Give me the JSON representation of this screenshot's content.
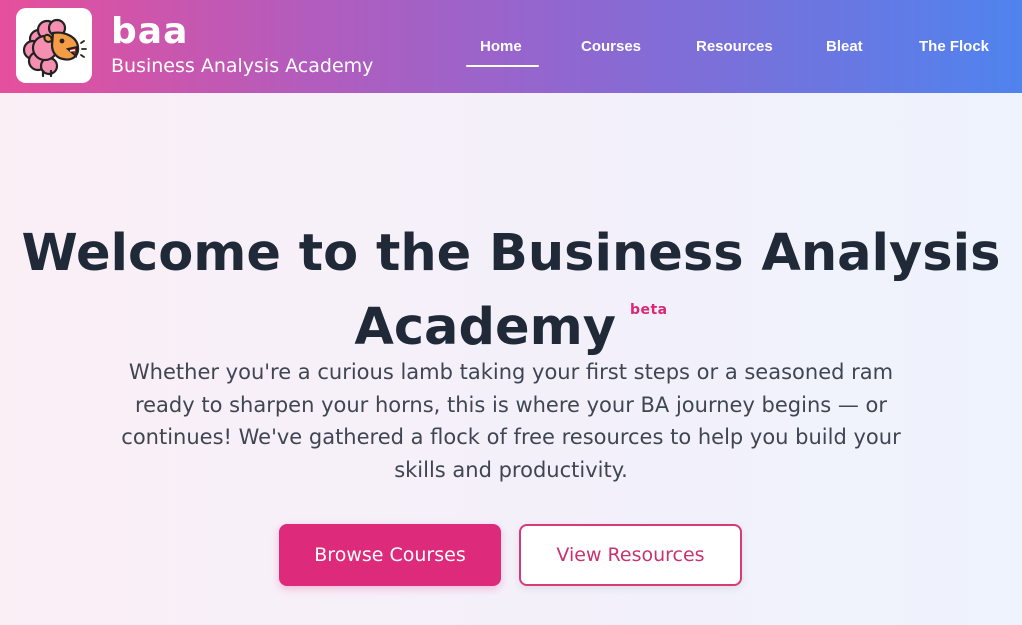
{
  "brand": {
    "name": "baa",
    "subtitle": "Business Analysis Academy",
    "logo_icon": "sheep-mascot-icon"
  },
  "nav": {
    "active": "Home",
    "items": [
      {
        "label": "Home"
      },
      {
        "label": "Courses"
      },
      {
        "label": "Resources"
      },
      {
        "label": "Bleat"
      },
      {
        "label": "The Flock"
      }
    ]
  },
  "hero": {
    "title": "Welcome to the Business Analysis Academy",
    "badge": "beta",
    "description": "Whether you're a curious lamb taking your first steps or a seasoned ram ready to sharpen your horns, this is where your BA journey begins — or continues! We've gathered a flock of free resources to help you build your skills and productivity.",
    "primary_button": "Browse Courses",
    "secondary_button": "View Resources"
  },
  "colors": {
    "header_gradient_start": "#e64f9b",
    "header_gradient_end": "#4f83ee",
    "primary": "#de2a7a",
    "text_dark": "#1f2937"
  }
}
